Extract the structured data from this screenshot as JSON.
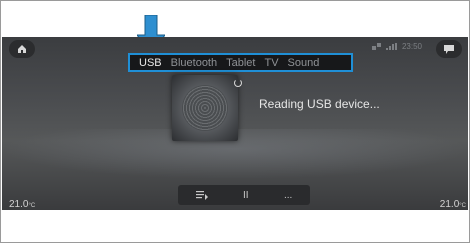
{
  "tabs": [
    {
      "label": "USB",
      "active": true
    },
    {
      "label": "Bluetooth",
      "active": false
    },
    {
      "label": "Tablet",
      "active": false
    },
    {
      "label": "TV",
      "active": false
    },
    {
      "label": "Sound",
      "active": false
    }
  ],
  "status": {
    "time": "23:50",
    "signal_icon": "signal-bars-icon",
    "wifi_icon": "connection-icon"
  },
  "player": {
    "message": "Reading USB device..."
  },
  "controls": {
    "playlist_icon": "playlist-icon",
    "pause_label": "II",
    "more_label": "..."
  },
  "climate": {
    "left_temp": "21.0",
    "left_unit": "°C",
    "right_temp": "21.0",
    "right_unit": "°C"
  },
  "icons": {
    "home": "home-icon",
    "messages": "message-icon",
    "pointer": "down-arrow-icon"
  },
  "colors": {
    "highlight": "#1f8fd6",
    "arrow": "#2e8fd0"
  }
}
